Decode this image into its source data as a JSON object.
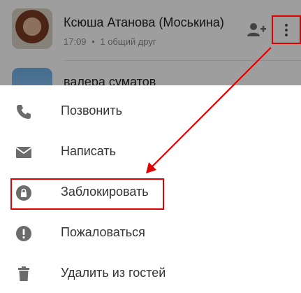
{
  "contacts": [
    {
      "name": "Ксюша Атанова (Моськина)",
      "time": "17:09",
      "separator": "•",
      "mutual": "1 общий друг"
    },
    {
      "name": "валера суматов"
    }
  ],
  "menu": {
    "items": [
      {
        "label": "Позвонить",
        "icon": "phone-icon"
      },
      {
        "label": "Написать",
        "icon": "envelope-icon"
      },
      {
        "label": "Заблокировать",
        "icon": "lock-icon"
      },
      {
        "label": "Пожаловаться",
        "icon": "exclamation-icon"
      },
      {
        "label": "Удалить из гостей",
        "icon": "trash-icon"
      }
    ]
  },
  "colors": {
    "highlight": "#e00000",
    "icon": "#6b6b6b",
    "text": "#333333"
  }
}
